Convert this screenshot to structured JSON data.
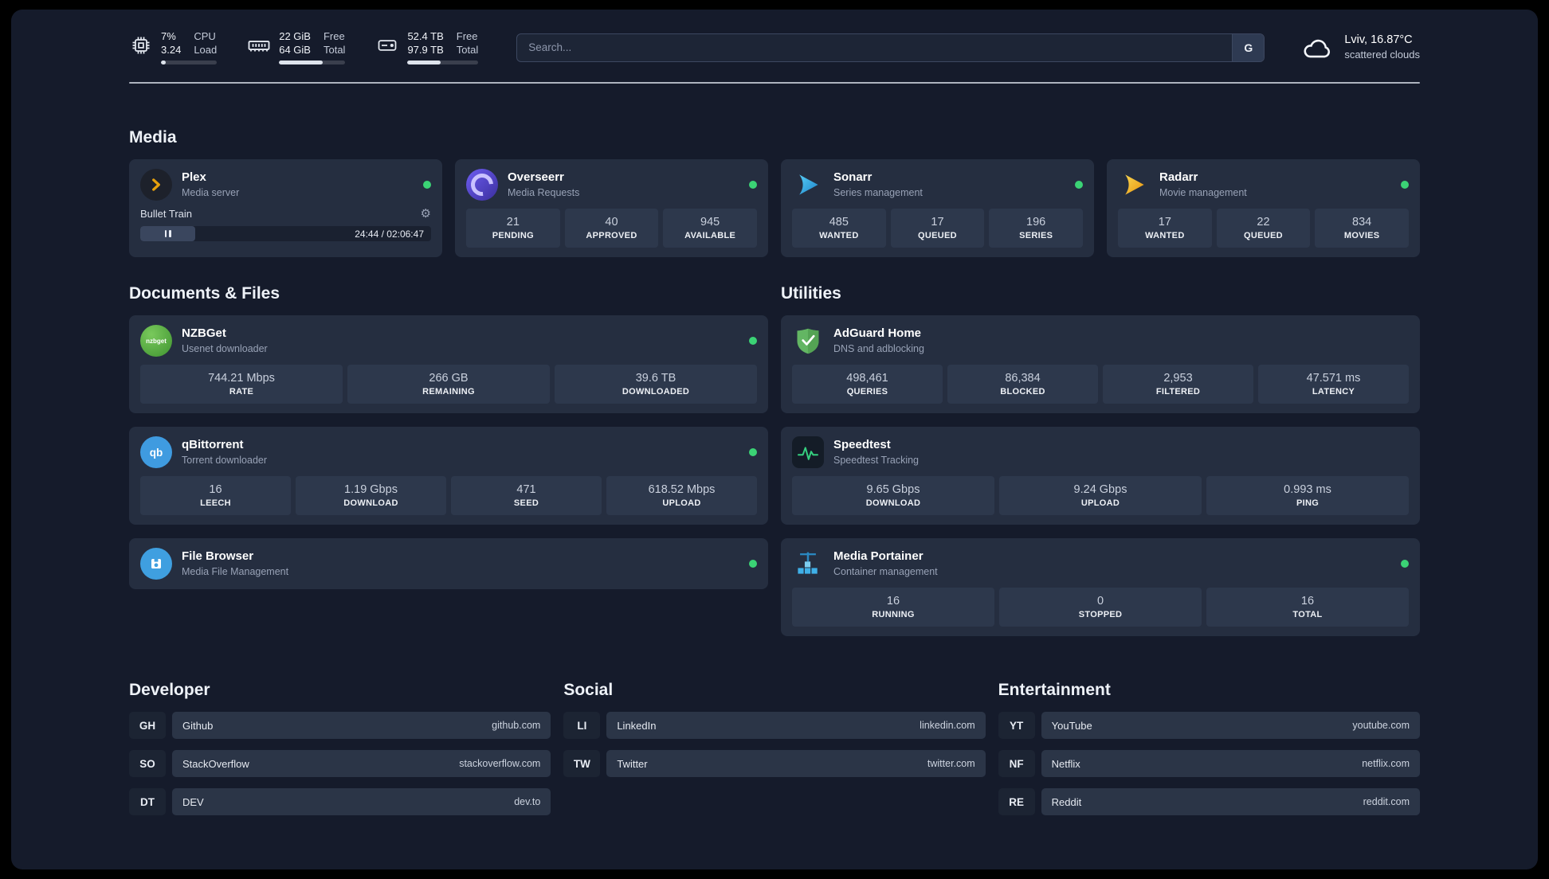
{
  "topbar": {
    "cpu": {
      "value1": "7%",
      "label1": "CPU",
      "value2": "3.24",
      "label2": "Load"
    },
    "ram": {
      "value1": "22 GiB",
      "label1": "Free",
      "value2": "64 GiB",
      "label2": "Total"
    },
    "disk": {
      "value1": "52.4 TB",
      "label1": "Free",
      "value2": "97.9 TB",
      "label2": "Total"
    },
    "search": {
      "placeholder": "Search...",
      "engine": "G"
    },
    "weather": {
      "location": "Lviv, 16.87°C",
      "condition": "scattered clouds"
    }
  },
  "media": {
    "section_title": "Media",
    "plex": {
      "title": "Plex",
      "subtitle": "Media server",
      "now_playing": "Bullet Train",
      "time": "24:44 / 02:06:47"
    },
    "overseerr": {
      "title": "Overseerr",
      "subtitle": "Media Requests",
      "stats": [
        {
          "value": "21",
          "label": "PENDING"
        },
        {
          "value": "40",
          "label": "APPROVED"
        },
        {
          "value": "945",
          "label": "AVAILABLE"
        }
      ]
    },
    "sonarr": {
      "title": "Sonarr",
      "subtitle": "Series management",
      "stats": [
        {
          "value": "485",
          "label": "WANTED"
        },
        {
          "value": "17",
          "label": "QUEUED"
        },
        {
          "value": "196",
          "label": "SERIES"
        }
      ]
    },
    "radarr": {
      "title": "Radarr",
      "subtitle": "Movie management",
      "stats": [
        {
          "value": "17",
          "label": "WANTED"
        },
        {
          "value": "22",
          "label": "QUEUED"
        },
        {
          "value": "834",
          "label": "MOVIES"
        }
      ]
    }
  },
  "documents": {
    "section_title": "Documents & Files",
    "nzbget": {
      "title": "NZBGet",
      "subtitle": "Usenet downloader",
      "icon_text": "nzbget",
      "stats": [
        {
          "value": "744.21 Mbps",
          "label": "RATE"
        },
        {
          "value": "266 GB",
          "label": "REMAINING"
        },
        {
          "value": "39.6 TB",
          "label": "DOWNLOADED"
        }
      ]
    },
    "qbittorrent": {
      "title": "qBittorrent",
      "subtitle": "Torrent downloader",
      "icon_text": "qb",
      "stats": [
        {
          "value": "16",
          "label": "LEECH"
        },
        {
          "value": "1.19 Gbps",
          "label": "DOWNLOAD"
        },
        {
          "value": "471",
          "label": "SEED"
        },
        {
          "value": "618.52 Mbps",
          "label": "UPLOAD"
        }
      ]
    },
    "filebrowser": {
      "title": "File Browser",
      "subtitle": "Media File Management"
    }
  },
  "utilities": {
    "section_title": "Utilities",
    "adguard": {
      "title": "AdGuard Home",
      "subtitle": "DNS and adblocking",
      "stats": [
        {
          "value": "498,461",
          "label": "QUERIES"
        },
        {
          "value": "86,384",
          "label": "BLOCKED"
        },
        {
          "value": "2,953",
          "label": "FILTERED"
        },
        {
          "value": "47.571 ms",
          "label": "LATENCY"
        }
      ]
    },
    "speedtest": {
      "title": "Speedtest",
      "subtitle": "Speedtest Tracking",
      "stats": [
        {
          "value": "9.65 Gbps",
          "label": "DOWNLOAD"
        },
        {
          "value": "9.24 Gbps",
          "label": "UPLOAD"
        },
        {
          "value": "0.993 ms",
          "label": "PING"
        }
      ]
    },
    "portainer": {
      "title": "Media Portainer",
      "subtitle": "Container management",
      "stats": [
        {
          "value": "16",
          "label": "RUNNING"
        },
        {
          "value": "0",
          "label": "STOPPED"
        },
        {
          "value": "16",
          "label": "TOTAL"
        }
      ]
    }
  },
  "bookmarks": {
    "developer": {
      "section_title": "Developer",
      "items": [
        {
          "abbr": "GH",
          "name": "Github",
          "url": "github.com"
        },
        {
          "abbr": "SO",
          "name": "StackOverflow",
          "url": "stackoverflow.com"
        },
        {
          "abbr": "DT",
          "name": "DEV",
          "url": "dev.to"
        }
      ]
    },
    "social": {
      "section_title": "Social",
      "items": [
        {
          "abbr": "LI",
          "name": "LinkedIn",
          "url": "linkedin.com"
        },
        {
          "abbr": "TW",
          "name": "Twitter",
          "url": "twitter.com"
        }
      ]
    },
    "entertainment": {
      "section_title": "Entertainment",
      "items": [
        {
          "abbr": "YT",
          "name": "YouTube",
          "url": "youtube.com"
        },
        {
          "abbr": "NF",
          "name": "Netflix",
          "url": "netflix.com"
        },
        {
          "abbr": "RE",
          "name": "Reddit",
          "url": "reddit.com"
        }
      ]
    }
  },
  "icons": {
    "gear": "⚙"
  },
  "colors": {
    "status_online": "#3bd375",
    "plex_amber": "#e5a00d",
    "background": "#151b2b",
    "card": "#252e40"
  }
}
